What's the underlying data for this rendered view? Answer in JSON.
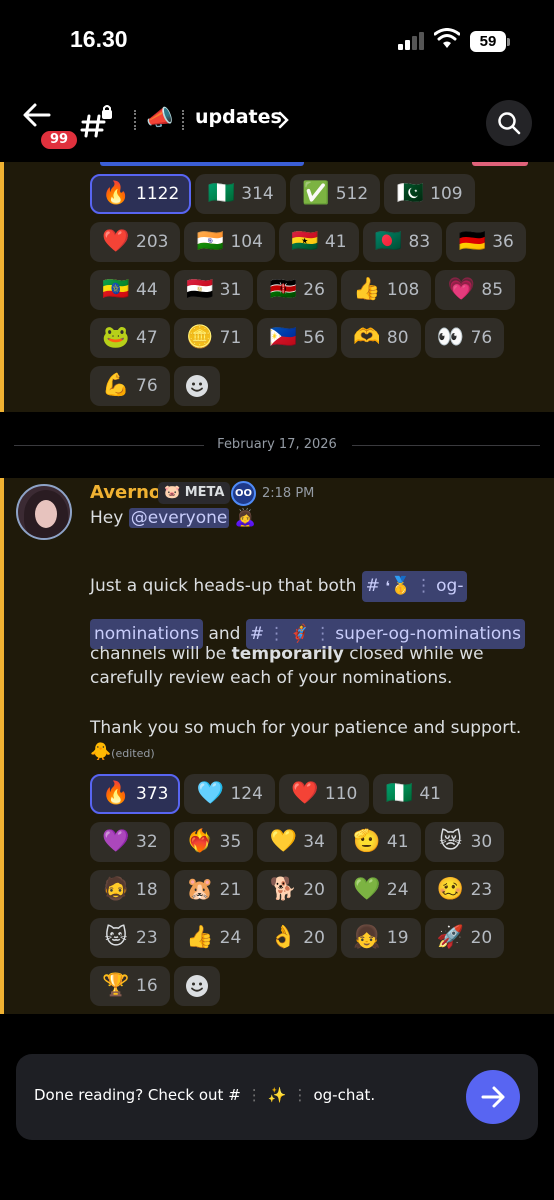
{
  "status_bar": {
    "time": "16.30",
    "battery": "59"
  },
  "header": {
    "unread_badge": "99",
    "channel_emoji": "📣",
    "channel_name": "updates"
  },
  "top_reactions": [
    {
      "emoji": "🔥",
      "count": "1122",
      "active": true
    },
    {
      "emoji": "🇳🇬",
      "count": "314"
    },
    {
      "emoji": "✅",
      "count": "512"
    },
    {
      "emoji": "🇵🇰",
      "count": "109"
    },
    {
      "emoji": "❤️",
      "count": "203"
    },
    {
      "emoji": "🇮🇳",
      "count": "104"
    },
    {
      "emoji": "🇬🇭",
      "count": "41"
    },
    {
      "emoji": "🇧🇩",
      "count": "83"
    },
    {
      "emoji": "🇩🇪",
      "count": "36"
    },
    {
      "emoji": "🇪🇹",
      "count": "44"
    },
    {
      "emoji": "🇪🇬",
      "count": "31"
    },
    {
      "emoji": "🇰🇪",
      "count": "26"
    },
    {
      "emoji": "👍",
      "count": "108"
    },
    {
      "emoji": "💗",
      "count": "85"
    },
    {
      "emoji": "🐸",
      "count": "47"
    },
    {
      "emoji": "🪙",
      "count": "71"
    },
    {
      "emoji": "🇵🇭",
      "count": "56"
    },
    {
      "emoji": "🫶",
      "count": "80"
    },
    {
      "emoji": "👀",
      "count": "76"
    },
    {
      "emoji": "💪",
      "count": "76"
    }
  ],
  "date_divider": "February 17, 2026",
  "message": {
    "author": "Averno",
    "role_tag": "🐷 META",
    "bot_badge": "OO",
    "time": "2:18 PM",
    "greeting": "Hey",
    "mention": "@everyone",
    "greeting_emoji": "🙇‍♀️",
    "line1_prefix": "Just a quick heads-up that both",
    "channel1_emoji": "🥇",
    "channel1_name": "og-",
    "channel1_name_cont": "nominations",
    "and_word": "and",
    "channel2_emoji": "🦸",
    "channel2_name": "super-og-nominations",
    "line3_a": "channels will be",
    "line3_bold": "temporarily",
    "line3_b": "closed while we carefully review each of your nominations.",
    "thanks": "Thank you so much for your patience and support.",
    "thanks_emoji": "🐥",
    "edited": "(edited)"
  },
  "message_reactions": [
    {
      "emoji": "🔥",
      "count": "373",
      "active": true
    },
    {
      "emoji": "🩵",
      "count": "124"
    },
    {
      "emoji": "❤️",
      "count": "110"
    },
    {
      "emoji": "🇳🇬",
      "count": "41"
    },
    {
      "emoji": "💜",
      "count": "32"
    },
    {
      "emoji": "❤️‍🔥",
      "count": "35"
    },
    {
      "emoji": "💛",
      "count": "34"
    },
    {
      "emoji": "🫡",
      "count": "41"
    },
    {
      "emoji": "😿",
      "count": "30"
    },
    {
      "emoji": "🧔",
      "count": "18"
    },
    {
      "emoji": "🐹",
      "count": "21"
    },
    {
      "emoji": "🐕",
      "count": "20"
    },
    {
      "emoji": "💚",
      "count": "24"
    },
    {
      "emoji": "🥴",
      "count": "23"
    },
    {
      "emoji": "🐱",
      "count": "23"
    },
    {
      "emoji": "👍",
      "count": "24"
    },
    {
      "emoji": "👌",
      "count": "20"
    },
    {
      "emoji": "👧",
      "count": "19"
    },
    {
      "emoji": "🚀",
      "count": "20"
    },
    {
      "emoji": "🏆",
      "count": "16"
    }
  ],
  "footer": {
    "prefix": "Done reading? Check out",
    "hash": "#",
    "channel_emoji": "✨",
    "channel_name": "og-chat."
  },
  "colors": {
    "accent": "#5865f2",
    "author": "#f0b232",
    "message_bg": "#1f1a0a",
    "active_reaction": "#2c3056"
  }
}
